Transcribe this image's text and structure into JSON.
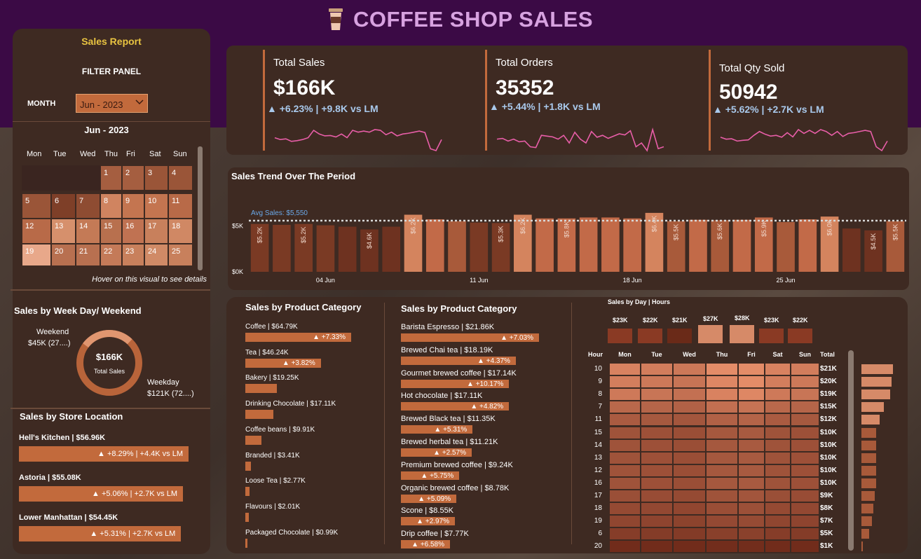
{
  "title": "COFFEE SHOP SALES",
  "left": {
    "report_title": "Sales Report",
    "filter_title": "FILTER PANEL",
    "month_label": "MONTH",
    "month_value": "Jun - 2023",
    "calendar_title": "Jun - 2023",
    "weekdays": [
      "Mon",
      "Tue",
      "Wed",
      "Thu",
      "Fri",
      "Sat",
      "Sun"
    ],
    "days": [
      "1",
      "2",
      "3",
      "4",
      "5",
      "6",
      "7",
      "8",
      "9",
      "10",
      "11",
      "12",
      "13",
      "14",
      "15",
      "16",
      "17",
      "18",
      "19",
      "20",
      "21",
      "22",
      "23",
      "24",
      "25"
    ],
    "hover_note": "Hover on this visual to see details",
    "weekday_section": "Sales by Week Day/ Weekend",
    "weekend_label": "Weekend",
    "weekend_value": "$45K (27....)",
    "weekday_label": "Weekday",
    "weekday_value": "$121K (72....)",
    "donut_value": "$166K",
    "donut_label": "Total Sales",
    "donut_data": {
      "weekend": 45,
      "weekday": 121
    },
    "store_section": "Sales by Store Location",
    "stores": [
      {
        "label": "Hell's Kitchen | $56.96K",
        "change": "▲ +8.29% | +4.4K vs LM",
        "value": 56.96
      },
      {
        "label": "Astoria | $55.08K",
        "change": "▲ +5.06% | +2.7K vs LM",
        "value": 55.08
      },
      {
        "label": "Lower Manhattan | $54.45K",
        "change": "▲ +5.31% | +2.7K vs LM",
        "value": 54.45
      }
    ]
  },
  "kpis": [
    {
      "label": "Total Sales",
      "value": "$166K",
      "change": "▲ +6.23% | +9.8K vs LM",
      "spark": [
        5,
        4.5,
        4.7,
        4,
        4.2,
        4.5,
        5,
        7,
        6,
        5.5,
        5.6,
        5.2,
        6,
        5,
        7,
        6.5,
        6.8,
        6.5,
        7.2,
        7,
        5.8,
        6.5,
        5.5,
        6,
        6.2,
        6.5,
        6.8,
        6.4,
        2,
        1.5,
        4.5
      ]
    },
    {
      "label": "Total Orders",
      "value": "35352",
      "change": "▲ +5.44% | +1.8K vs LM",
      "spark": [
        5,
        5.2,
        4.5,
        5,
        4.3,
        4.5,
        3,
        2.8,
        6,
        5.8,
        5.6,
        5,
        6,
        4,
        6.8,
        5,
        4,
        7,
        5.5,
        6,
        5.2,
        5.8,
        6.4,
        6.1,
        7.2,
        3,
        4,
        2,
        7.5,
        2.5,
        3
      ]
    },
    {
      "label": "Total Qty Sold",
      "value": "50942",
      "change": "▲ +5.62% | +2.7K vs LM",
      "spark": [
        5,
        4.5,
        4.6,
        4,
        4.2,
        4.3,
        5.5,
        6.5,
        5.8,
        5.3,
        5.5,
        5,
        6.2,
        5.1,
        7,
        6,
        6.8,
        6,
        7,
        6.5,
        5.5,
        6.5,
        5.2,
        6,
        6.2,
        6.5,
        6.8,
        6.5,
        2.5,
        1.5,
        4
      ]
    }
  ],
  "trend": {
    "title": "Sales Trend Over The Period",
    "avg_label": "Avg Sales: $5,550",
    "y_ticks": [
      "$5K",
      "$0K"
    ],
    "x_ticks": [
      "04 Jun",
      "11 Jun",
      "18 Jun",
      "25 Jun"
    ]
  },
  "chart_data": {
    "type": "bar",
    "title": "Sales Trend Over The Period",
    "ylim": [
      0,
      7000
    ],
    "average": 5550,
    "categories": [
      "1",
      "2",
      "3",
      "4",
      "5",
      "6",
      "7",
      "8",
      "9",
      "10",
      "11",
      "12",
      "13",
      "14",
      "15",
      "16",
      "17",
      "18",
      "19",
      "20",
      "21",
      "22",
      "23",
      "24",
      "25",
      "26",
      "27",
      "28",
      "29",
      "30"
    ],
    "values": [
      5200,
      5100,
      5200,
      5050,
      4900,
      4600,
      4900,
      6200,
      5700,
      5500,
      5350,
      5300,
      6200,
      5800,
      5800,
      5900,
      5900,
      5800,
      6400,
      5500,
      5650,
      5600,
      5650,
      5900,
      5400,
      5700,
      6000,
      4700,
      4500,
      5500
    ],
    "value_labels": [
      "$5.2K",
      "",
      "$5.2K",
      "",
      "",
      "$4.6K",
      "",
      "$6.2K",
      "",
      "",
      "",
      "$5.3K",
      "$6.2K",
      "",
      "$5.8K",
      "",
      "",
      "",
      "$6.4K",
      "$5.5K",
      "",
      "$5.6K",
      "",
      "$5.9K",
      "",
      "",
      "$6.0K",
      "",
      "$4.5K",
      "$5.5K"
    ]
  },
  "cat1": {
    "title": "Sales by Product Category",
    "items": [
      {
        "label": "Coffee | $64.79K",
        "change": "▲ +7.33%",
        "value": 64.79
      },
      {
        "label": "Tea | $46.24K",
        "change": "▲ +3.82%",
        "value": 46.24
      },
      {
        "label": "Bakery | $19.25K",
        "change": "",
        "value": 19.25
      },
      {
        "label": "Drinking Chocolate | $17.11K",
        "change": "",
        "value": 17.11
      },
      {
        "label": "Coffee beans | $9.91K",
        "change": "",
        "value": 9.91
      },
      {
        "label": "Branded | $3.41K",
        "change": "",
        "value": 3.41
      },
      {
        "label": "Loose Tea | $2.77K",
        "change": "",
        "value": 2.77
      },
      {
        "label": "Flavours | $2.01K",
        "change": "",
        "value": 2.01
      },
      {
        "label": "Packaged Chocolate | $0.99K",
        "change": "",
        "value": 0.99
      }
    ]
  },
  "cat2": {
    "title": "Sales by Product Category",
    "items": [
      {
        "label": "Barista Espresso | $21.86K",
        "change": "▲ +7.03%",
        "value": 21.86
      },
      {
        "label": "Brewed Chai tea | $18.19K",
        "change": "▲ +4.37%",
        "value": 18.19
      },
      {
        "label": "Gourmet brewed coffee | $17.14K",
        "change": "▲ +10.17%",
        "value": 17.14
      },
      {
        "label": "Hot chocolate | $17.11K",
        "change": "▲ +4.82%",
        "value": 17.11
      },
      {
        "label": "Brewed Black tea | $11.35K",
        "change": "▲ +5.31%",
        "value": 11.35
      },
      {
        "label": "Brewed herbal tea | $11.21K",
        "change": "▲ +2.57%",
        "value": 11.21
      },
      {
        "label": "Premium brewed coffee | $9.24K",
        "change": "▲ +5.75%",
        "value": 9.24
      },
      {
        "label": "Organic brewed coffee | $8.78K",
        "change": "▲ +5.09%",
        "value": 8.78
      },
      {
        "label": "Scone | $8.55K",
        "change": "▲ +2.97%",
        "value": 8.55
      },
      {
        "label": "Drip coffee | $7.77K",
        "change": "▲ +6.58%",
        "value": 7.77
      }
    ]
  },
  "heatmap": {
    "title": "Sales by Day | Hours",
    "day_totals": [
      "$23K",
      "$22K",
      "$21K",
      "$27K",
      "$28K",
      "$23K",
      "$22K"
    ],
    "day_total_values": [
      23,
      22,
      21,
      27,
      28,
      23,
      22
    ],
    "hour_header": "Hour",
    "total_header": "Total",
    "days": [
      "Mon",
      "Tue",
      "Wed",
      "Thu",
      "Fri",
      "Sat",
      "Sun"
    ],
    "hours": [
      "10",
      "9",
      "8",
      "7",
      "11",
      "15",
      "14",
      "13",
      "12",
      "16",
      "17",
      "18",
      "19",
      "6",
      "20"
    ],
    "hour_totals": [
      "$21K",
      "$20K",
      "$19K",
      "$15K",
      "$12K",
      "$10K",
      "$10K",
      "$10K",
      "$10K",
      "$10K",
      "$9K",
      "$8K",
      "$7K",
      "$5K",
      "$1K"
    ],
    "hour_total_values": [
      21,
      20,
      19,
      15,
      12,
      10,
      10,
      10,
      10,
      10,
      9,
      8,
      7,
      5,
      1
    ]
  }
}
